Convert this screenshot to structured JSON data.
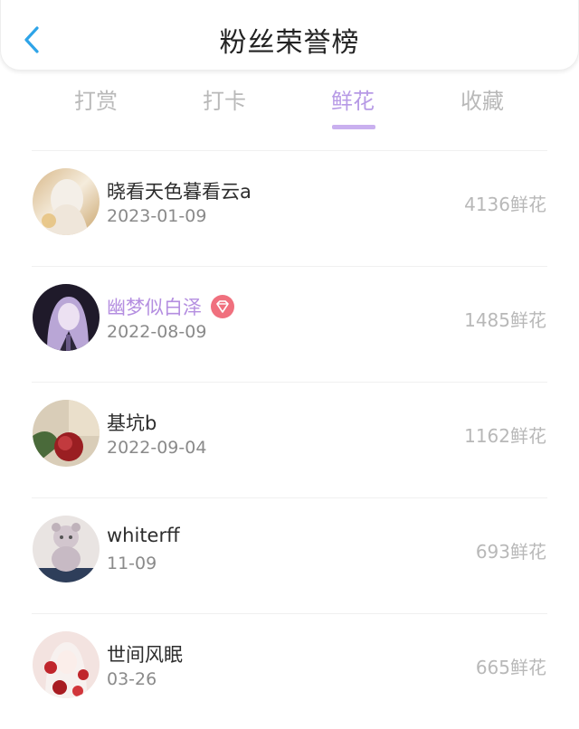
{
  "header": {
    "title": "粉丝荣誉榜"
  },
  "tabs": [
    {
      "label": "打赏",
      "active": false
    },
    {
      "label": "打卡",
      "active": false
    },
    {
      "label": "鲜花",
      "active": true
    },
    {
      "label": "收藏",
      "active": false
    }
  ],
  "colors": {
    "accent": "#b79ae6",
    "vip_name": "#b48ee0",
    "back_icon": "#2ea4e8",
    "badge": "#f0707e"
  },
  "fans": [
    {
      "name": "晓看天色暮看云a",
      "date": "2023-01-09",
      "count": "4136鲜花",
      "vip": false
    },
    {
      "name": "幽梦似白泽",
      "date": "2022-08-09",
      "count": "1485鲜花",
      "vip": true
    },
    {
      "name": "基坑b",
      "date": "2022-09-04",
      "count": "1162鲜花",
      "vip": false
    },
    {
      "name": "whiterff",
      "date": "11-09",
      "count": "693鲜花",
      "vip": false
    },
    {
      "name": "世间风眠",
      "date": "03-26",
      "count": "665鲜花",
      "vip": false
    }
  ]
}
